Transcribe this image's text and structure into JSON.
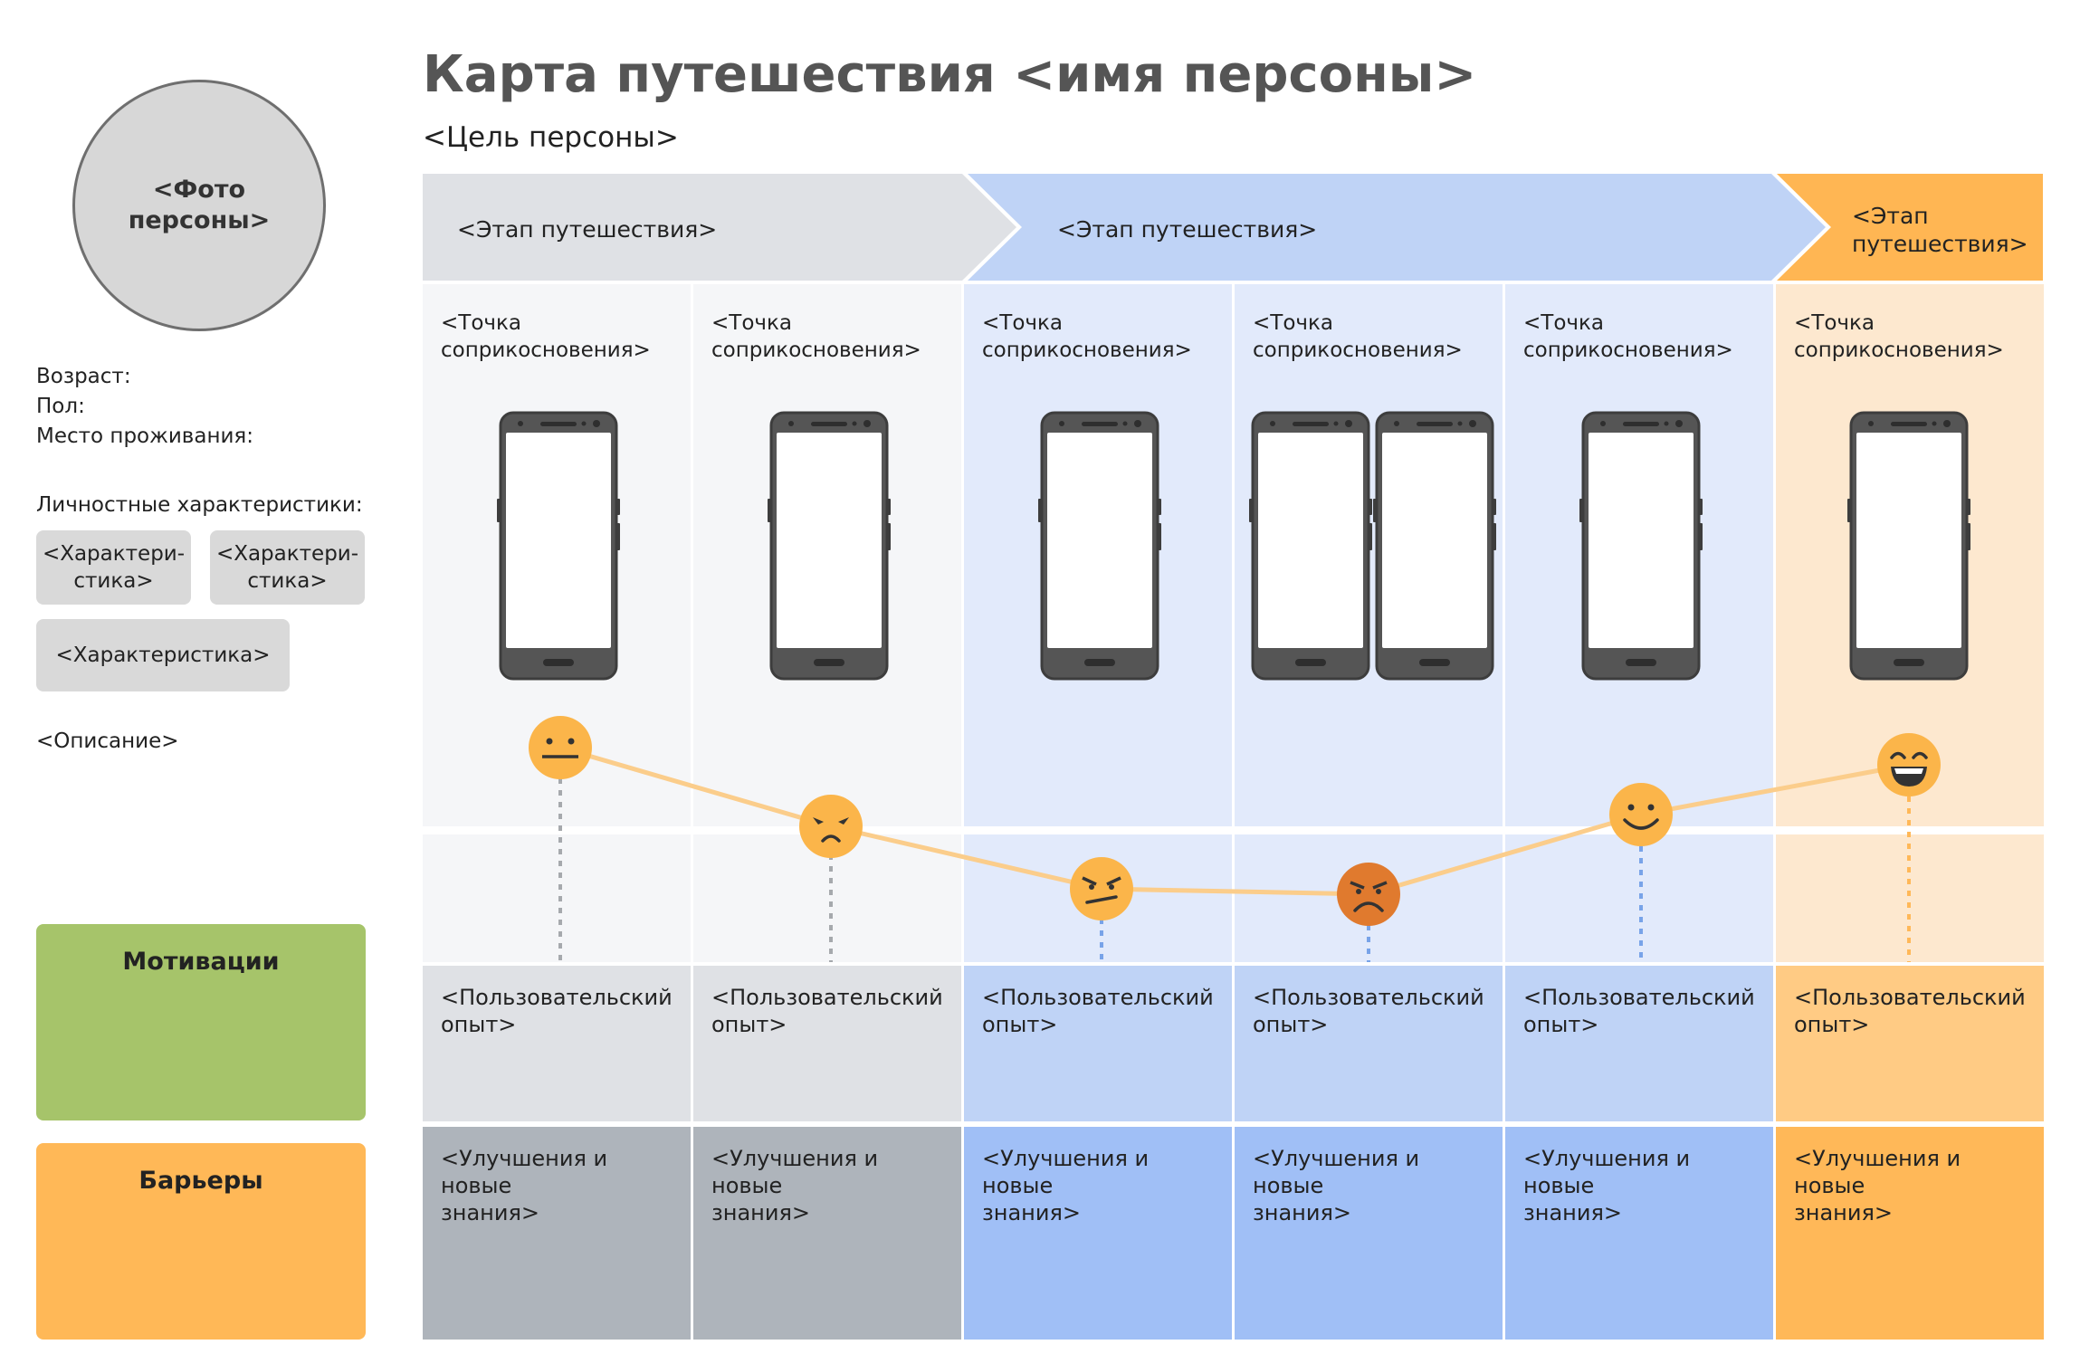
{
  "title": "Карта путешествия <имя персоны>",
  "goal": "<Цель персоны>",
  "persona": {
    "photo_label_line1": "<Фото",
    "photo_label_line2": "персоны>",
    "age_label": "Возраст:",
    "gender_label": "Пол:",
    "residence_label": "Место проживания:",
    "traits_label": "Личностные характеристики:",
    "trait1_line1": "<Характери-",
    "trait1_line2": "стика>",
    "trait2_line1": "<Характери-",
    "trait2_line2": "стика>",
    "trait3": "<Характеристика>",
    "description": "<Описание>",
    "motivations": "Мотивации",
    "barriers": "Барьеры"
  },
  "stages": [
    {
      "line1": "<Этап путешествия>",
      "line2": ""
    },
    {
      "line1": "<Этап путешествия>",
      "line2": ""
    },
    {
      "line1": "<Этап",
      "line2": "путешествия>"
    }
  ],
  "columns": [
    {
      "touchpoint_line1": "<Точка",
      "touchpoint_line2": "соприкосновения>",
      "experience_line1": "<Пользовательский",
      "experience_line2": "опыт>",
      "improvement_line1": "<Улучшения и новые",
      "improvement_line2": "знания>",
      "emotion": "neutral-face-icon"
    },
    {
      "touchpoint_line1": "<Точка",
      "touchpoint_line2": "соприкосновения>",
      "experience_line1": "<Пользовательский",
      "experience_line2": "опыт>",
      "improvement_line1": "<Улучшения и новые",
      "improvement_line2": "знания>",
      "emotion": "worried-face-icon"
    },
    {
      "touchpoint_line1": "<Точка",
      "touchpoint_line2": "соприкосновения>",
      "experience_line1": "<Пользовательский",
      "experience_line2": "опыт>",
      "improvement_line1": "<Улучшения и новые",
      "improvement_line2": "знания>",
      "emotion": "annoyed-face-icon"
    },
    {
      "touchpoint_line1": "<Точка",
      "touchpoint_line2": "соприкосновения>",
      "experience_line1": "<Пользовательский",
      "experience_line2": "опыт>",
      "improvement_line1": "<Улучшения и новые",
      "improvement_line2": "знания>",
      "emotion": "angry-face-icon"
    },
    {
      "touchpoint_line1": "<Точка",
      "touchpoint_line2": "соприкосновения>",
      "experience_line1": "<Пользовательский",
      "experience_line2": "опыт>",
      "improvement_line1": "<Улучшения и новые",
      "improvement_line2": "знания>",
      "emotion": "smiling-face-icon"
    },
    {
      "touchpoint_line1": "<Точка",
      "touchpoint_line2": "соприкосновения>",
      "experience_line1": "<Пользовательский",
      "experience_line2": "опыт>",
      "improvement_line1": "<Улучшения и новые",
      "improvement_line2": "знания>",
      "emotion": "grinning-face-icon"
    }
  ],
  "colors": {
    "gray_stage": "#dfe1e5",
    "blue_stage": "#bfd3f6",
    "orange_stage": "#ffb653",
    "gray_touch": "#f5f6f8",
    "blue_touch": "#e2eafb",
    "orange_touch": "#fde8cf",
    "gray_exp": "#dfe1e5",
    "blue_exp": "#bfd3f6",
    "orange_exp": "#ffcb84",
    "gray_imp": "#aeb4bb",
    "blue_imp": "#a0bff6",
    "orange_imp": "#ffb858",
    "emotion_line": "#fbcd8b",
    "face_yellow": "#fbb54a",
    "face_angry": "#e07a2e"
  }
}
